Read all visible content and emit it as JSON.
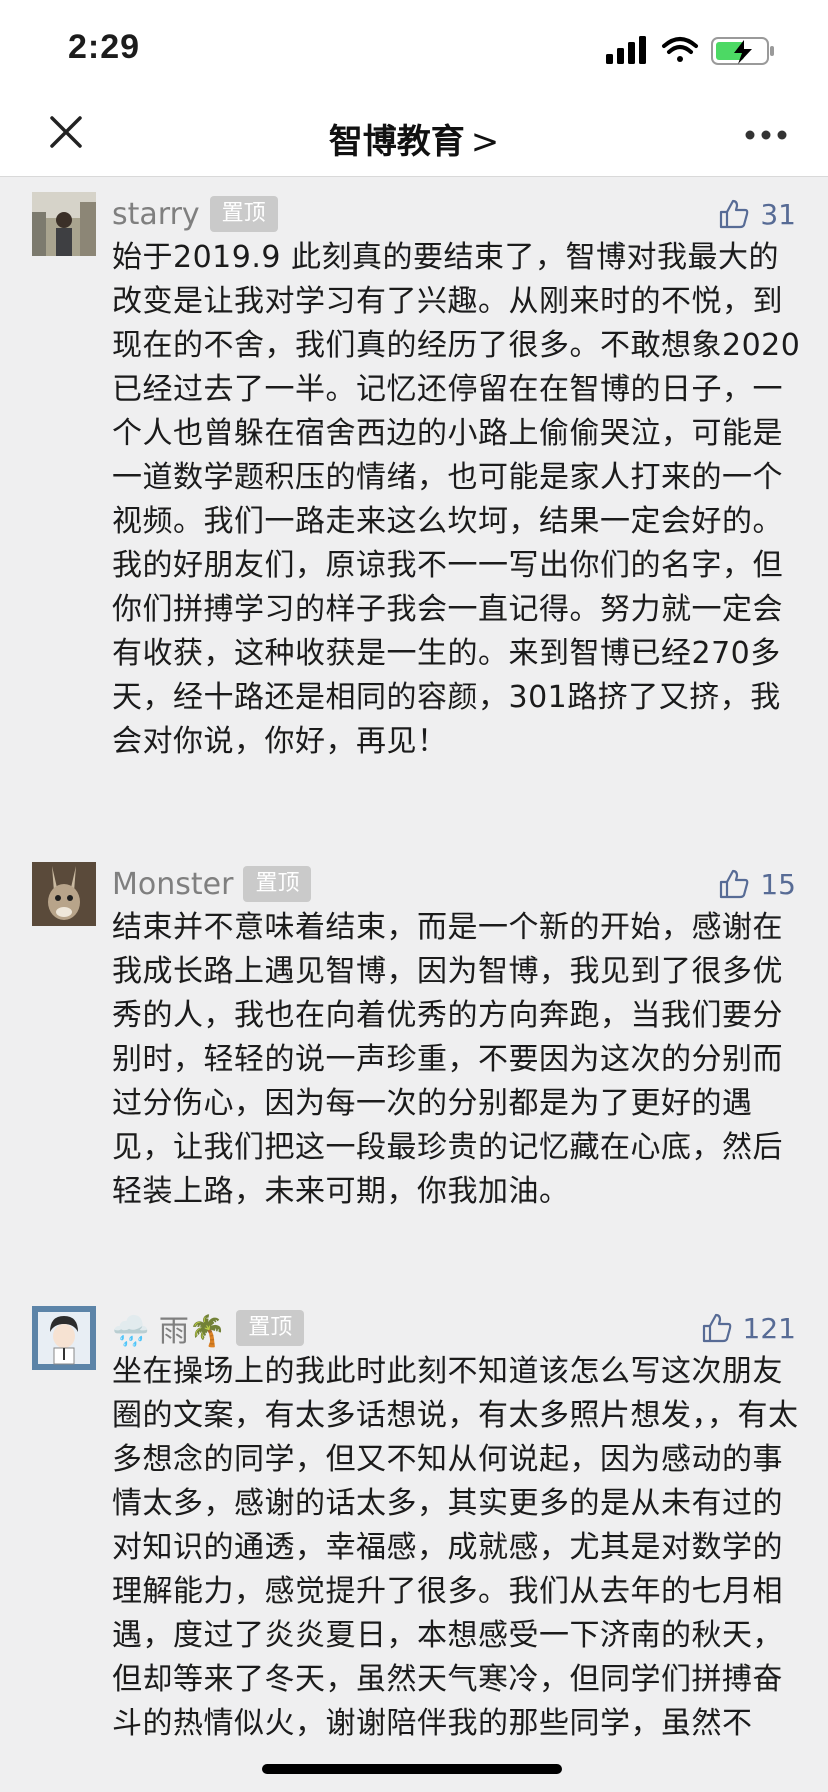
{
  "status": {
    "time": "2:29"
  },
  "nav": {
    "title": "智博教育",
    "chevron": ">"
  },
  "comments": [
    {
      "user": "starry",
      "badge": "置顶",
      "likes": "31",
      "text": "始于2019.9  此刻真的要结束了，智博对我最大的改变是让我对学习有了兴趣。从刚来时的不悦，到现在的不舍，我们真的经历了很多。不敢想象2020已经过去了一半。记忆还停留在在智博的日子，一个人也曾躲在宿舍西边的小路上偷偷哭泣，可能是一道数学题积压的情绪，也可能是家人打来的一个视频。我们一路走来这么坎坷，结果一定会好的。我的好朋友们，原谅我不一一写出你们的名字，但你们拼搏学习的样子我会一直记得。努力就一定会有收获，这种收获是一生的。来到智博已经270多天，经十路还是相同的容颜，301路挤了又挤，我会对你说，你好，再见！"
    },
    {
      "user": "Monster",
      "badge": "置顶",
      "likes": "15",
      "text": "结束并不意味着结束，而是一个新的开始，感谢在我成长路上遇见智博，因为智博，我见到了很多优秀的人，我也在向着优秀的方向奔跑，当我们要分别时，轻轻的说一声珍重，不要因为这次的分别而过分伤心，因为每一次的分别都是为了更好的遇见，让我们把这一段最珍贵的记忆藏在心底，然后轻装上路，未来可期，你我加油。"
    },
    {
      "user": "🌧️ 雨🌴",
      "badge": "置顶",
      "likes": "121",
      "text": "坐在操场上的我此时此刻不知道该怎么写这次朋友圈的文案，有太多话想说，有太多照片想发，，有太多想念的同学，但又不知从何说起，因为感动的事情太多，感谢的话太多，其实更多的是从未有过的对知识的通透，幸福感，成就感，尤其是对数学的理解能力，感觉提升了很多。我们从去年的七月相遇，度过了炎炎夏日，本想感受一下济南的秋天，但却等来了冬天，虽然天气寒冷，但同学们拼搏奋斗的热情似火，谢谢陪伴我的那些同学，虽然不"
    }
  ],
  "colors": {
    "link": "#576b95",
    "badge_bg": "#cacaca",
    "background": "#efeff0"
  },
  "icons": [
    "signal-icon",
    "wifi-icon",
    "battery-charging-icon",
    "close-icon",
    "more-icon",
    "thumbs-up-icon"
  ]
}
